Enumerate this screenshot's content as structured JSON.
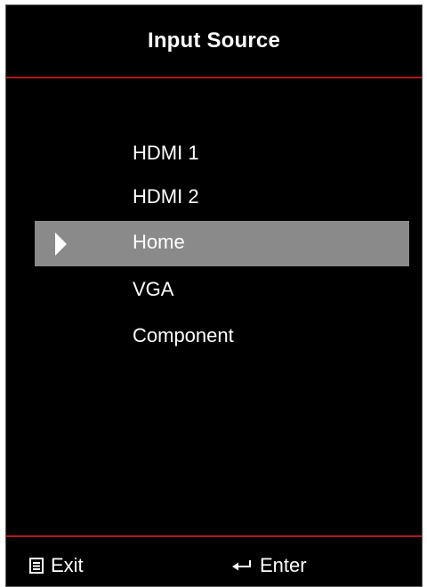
{
  "menu": {
    "title": "Input Source",
    "accent_color": "#b01818",
    "selected_color": "#8a8a8a",
    "items": [
      {
        "label": "HDMI 1",
        "selected": false
      },
      {
        "label": "HDMI 2",
        "selected": false
      },
      {
        "label": "Home",
        "selected": true
      },
      {
        "label": "VGA",
        "selected": false
      },
      {
        "label": "Component",
        "selected": false
      }
    ]
  },
  "footer": {
    "exit": {
      "label": "Exit",
      "icon": "menu-icon"
    },
    "enter": {
      "label": "Enter",
      "icon": "enter-return-icon"
    }
  }
}
